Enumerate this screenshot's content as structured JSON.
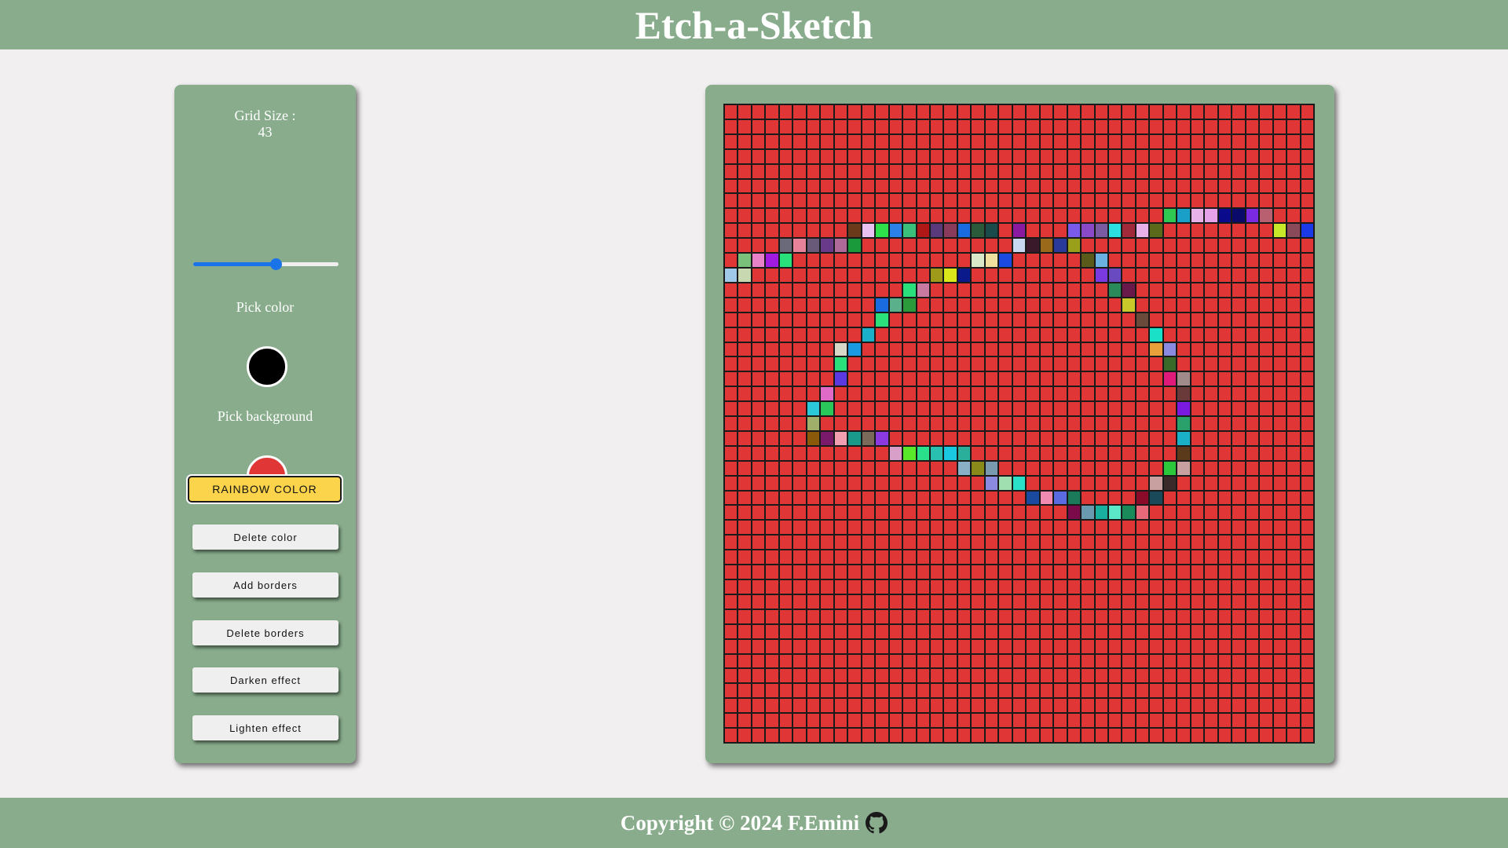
{
  "header": {
    "title": "Etch-a-Sketch"
  },
  "controls": {
    "grid_size_label": "Grid Size :",
    "grid_size_value": "43",
    "slider": {
      "min": 1,
      "max": 75,
      "value": 43
    },
    "pick_color_label": "Pick color",
    "pick_color_value": "#000000",
    "pick_background_label": "Pick background",
    "pick_background_value": "#e03636",
    "buttons": {
      "rainbow": "RAINBOW COLOR",
      "delete_color": "Delete color",
      "add_borders": "Add borders",
      "delete_borders": "Delete borders",
      "darken": "Darken effect",
      "lighten": "Lighten effect"
    }
  },
  "grid": {
    "size": 43,
    "background": "#e03636",
    "painted": [
      [
        7,
        32,
        "#2fc852"
      ],
      [
        7,
        33,
        "#1aa0c8"
      ],
      [
        7,
        34,
        "#e8b2e8"
      ],
      [
        7,
        35,
        "#e6a2e8"
      ],
      [
        7,
        36,
        "#0a0a8c"
      ],
      [
        7,
        37,
        "#0a0a6a"
      ],
      [
        7,
        38,
        "#7a2ae0"
      ],
      [
        7,
        39,
        "#b86070"
      ],
      [
        8,
        9,
        "#6a3a1a"
      ],
      [
        8,
        10,
        "#e8c2f0"
      ],
      [
        8,
        11,
        "#2ee04a"
      ],
      [
        8,
        12,
        "#2a82e8"
      ],
      [
        8,
        13,
        "#3ac07a"
      ],
      [
        8,
        14,
        "#b01818"
      ],
      [
        8,
        15,
        "#5a3a7a"
      ],
      [
        8,
        16,
        "#8a3a5a"
      ],
      [
        8,
        17,
        "#1a6ae0"
      ],
      [
        8,
        18,
        "#2a5a3a"
      ],
      [
        8,
        19,
        "#1a4a4a"
      ],
      [
        8,
        21,
        "#8a1aa0"
      ],
      [
        8,
        25,
        "#7a5ae8"
      ],
      [
        8,
        26,
        "#8a4ac8"
      ],
      [
        8,
        27,
        "#7a5aa0"
      ],
      [
        8,
        28,
        "#2ae0e0"
      ],
      [
        8,
        29,
        "#a02a3a"
      ],
      [
        8,
        30,
        "#e8b2e8"
      ],
      [
        8,
        31,
        "#5a6a1a"
      ],
      [
        8,
        40,
        "#c8e82a"
      ],
      [
        8,
        41,
        "#8a4a5a"
      ],
      [
        8,
        42,
        "#1a3ae8"
      ],
      [
        9,
        4,
        "#6a6a7a"
      ],
      [
        9,
        5,
        "#e8829a"
      ],
      [
        9,
        6,
        "#6a5a7a"
      ],
      [
        9,
        7,
        "#6a3a8a"
      ],
      [
        9,
        8,
        "#b06a9a"
      ],
      [
        9,
        9,
        "#1a9a3a"
      ],
      [
        9,
        21,
        "#c8d8f0"
      ],
      [
        9,
        22,
        "#3a1a2a"
      ],
      [
        9,
        23,
        "#9a6a1a"
      ],
      [
        9,
        24,
        "#2a3a9a"
      ],
      [
        9,
        25,
        "#9aa01a"
      ],
      [
        10,
        1,
        "#7ac07a"
      ],
      [
        10,
        2,
        "#e882c8"
      ],
      [
        10,
        3,
        "#a01ae0"
      ],
      [
        10,
        4,
        "#2ae07a"
      ],
      [
        10,
        18,
        "#d8e8c8"
      ],
      [
        10,
        19,
        "#f0e0a0"
      ],
      [
        10,
        20,
        "#1a4ae0"
      ],
      [
        10,
        26,
        "#5a5a1a"
      ],
      [
        10,
        27,
        "#6ab0e0"
      ],
      [
        11,
        0,
        "#a0c8e8"
      ],
      [
        11,
        1,
        "#c8d8b0"
      ],
      [
        11,
        15,
        "#a09a1a"
      ],
      [
        11,
        16,
        "#d8e81a"
      ],
      [
        11,
        17,
        "#0a1a8a"
      ],
      [
        11,
        27,
        "#7a3ae0"
      ],
      [
        11,
        28,
        "#6a4ac0"
      ],
      [
        12,
        13,
        "#2ae07a"
      ],
      [
        12,
        14,
        "#c87aa0"
      ],
      [
        12,
        28,
        "#2a8a5a"
      ],
      [
        12,
        29,
        "#6a1a4a"
      ],
      [
        13,
        11,
        "#1a6ae0"
      ],
      [
        13,
        12,
        "#5ab08a"
      ],
      [
        13,
        13,
        "#2a9a3a"
      ],
      [
        13,
        29,
        "#c8c82a"
      ],
      [
        14,
        11,
        "#2ae07a"
      ],
      [
        14,
        30,
        "#6a4a3a"
      ],
      [
        15,
        10,
        "#1ab0c8"
      ],
      [
        15,
        31,
        "#1ae0c8"
      ],
      [
        16,
        8,
        "#d8d8c8"
      ],
      [
        16,
        9,
        "#1a9ae0"
      ],
      [
        16,
        31,
        "#e8a03a"
      ],
      [
        16,
        32,
        "#8a8ae0"
      ],
      [
        17,
        8,
        "#2ae07a"
      ],
      [
        17,
        32,
        "#3a6a2a"
      ],
      [
        18,
        8,
        "#5a3ae0"
      ],
      [
        18,
        32,
        "#e01a7a"
      ],
      [
        18,
        33,
        "#a08a8a"
      ],
      [
        19,
        7,
        "#e06ac8"
      ],
      [
        19,
        33,
        "#6a3a3a"
      ],
      [
        20,
        6,
        "#2ac8d8"
      ],
      [
        20,
        7,
        "#2ac85a"
      ],
      [
        20,
        33,
        "#7a1ae0"
      ],
      [
        21,
        6,
        "#a0b06a"
      ],
      [
        21,
        33,
        "#2aa06a"
      ],
      [
        22,
        6,
        "#8a5a0a"
      ],
      [
        22,
        7,
        "#7a1a6a"
      ],
      [
        22,
        8,
        "#f0a0b0"
      ],
      [
        22,
        9,
        "#1a9a8a"
      ],
      [
        22,
        10,
        "#7a6a5a"
      ],
      [
        22,
        11,
        "#8a3ae0"
      ],
      [
        22,
        33,
        "#1ab0c8"
      ],
      [
        23,
        12,
        "#d8a0c8"
      ],
      [
        23,
        13,
        "#5ae82a"
      ],
      [
        23,
        14,
        "#2ae08a"
      ],
      [
        23,
        15,
        "#2ac0b0"
      ],
      [
        23,
        16,
        "#1ac8e0"
      ],
      [
        23,
        17,
        "#2ab09a"
      ],
      [
        23,
        33,
        "#5a3a1a"
      ],
      [
        24,
        17,
        "#8ab0c8"
      ],
      [
        24,
        18,
        "#8a8a1a"
      ],
      [
        24,
        19,
        "#7a9ab0"
      ],
      [
        24,
        32,
        "#2ac83a"
      ],
      [
        24,
        33,
        "#c8a0a0"
      ],
      [
        25,
        19,
        "#8a8ae0"
      ],
      [
        25,
        20,
        "#a0e0b0"
      ],
      [
        25,
        21,
        "#2ae0c8"
      ],
      [
        25,
        31,
        "#c8a0a0"
      ],
      [
        25,
        32,
        "#3a2a2a"
      ],
      [
        26,
        22,
        "#1a4aa0"
      ],
      [
        26,
        23,
        "#f08ab0"
      ],
      [
        26,
        24,
        "#5a6ae0"
      ],
      [
        26,
        25,
        "#1a7a5a"
      ],
      [
        26,
        30,
        "#8a0a2a"
      ],
      [
        26,
        31,
        "#1a4a5a"
      ],
      [
        27,
        25,
        "#7a0a4a"
      ],
      [
        27,
        26,
        "#6a9ab0"
      ],
      [
        27,
        27,
        "#1ab0a0"
      ],
      [
        27,
        28,
        "#5ae8c8"
      ],
      [
        27,
        29,
        "#1a8a5a"
      ],
      [
        27,
        30,
        "#e86a7a"
      ]
    ]
  },
  "footer": {
    "text": "Copyright © 2024 F.Emini"
  }
}
